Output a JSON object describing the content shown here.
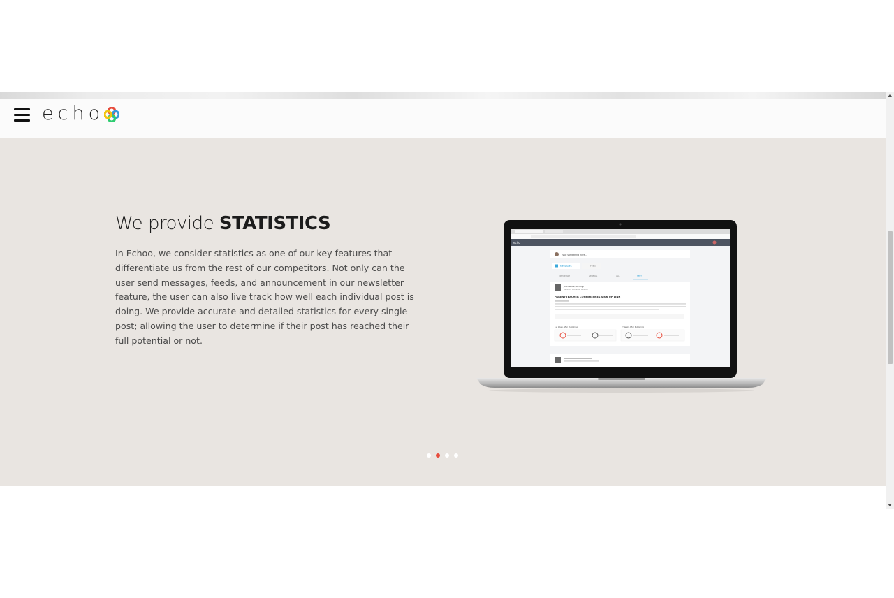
{
  "brand": {
    "name": "echo"
  },
  "hero": {
    "headline_light": "We provide ",
    "headline_bold": "STATISTICS",
    "paragraph": "In Echoo, we consider statistics as one of our key features that differentiate us from the rest of our competitors. Not only can the user send messages, feeds, and announcement in our newsletter feature, the user can also live track how well each individual post is doing. We provide accurate and detailed statistics for every single post; allowing the user to determine if their post has reached their full potential or not."
  },
  "screen": {
    "compose_placeholder": "Type something here...",
    "tab_messages": "MESSAGES",
    "tab_feed": "FEED",
    "filters": [
      "IMPORTANT",
      "GENERAL",
      "ALL",
      "SENT"
    ],
    "post_author": "John Snow, 5th Yrgl",
    "post_audience": "All Staff, Students, Parents",
    "post_title": "PARENT-TEACHER CONFERENCES SIGN UP LINK",
    "stats_1": "1st Week After Publishing",
    "stats_2": "2 Weeks After Publishing"
  },
  "carousel": {
    "slide_count": 4,
    "active_index": 1
  },
  "colors": {
    "hero_bg": "#e9e5e1",
    "accent": "#e74c3c",
    "screen_header": "#4d5461",
    "logo_red": "#e74c3c",
    "logo_blue": "#3498db",
    "logo_green": "#2ecc71",
    "logo_yellow": "#f1c40f"
  },
  "icons": {
    "menu": "hamburger-icon",
    "logo": "pinwheel-logo-icon",
    "scroll_up": "chevron-up-icon",
    "scroll_down": "chevron-down-icon"
  }
}
